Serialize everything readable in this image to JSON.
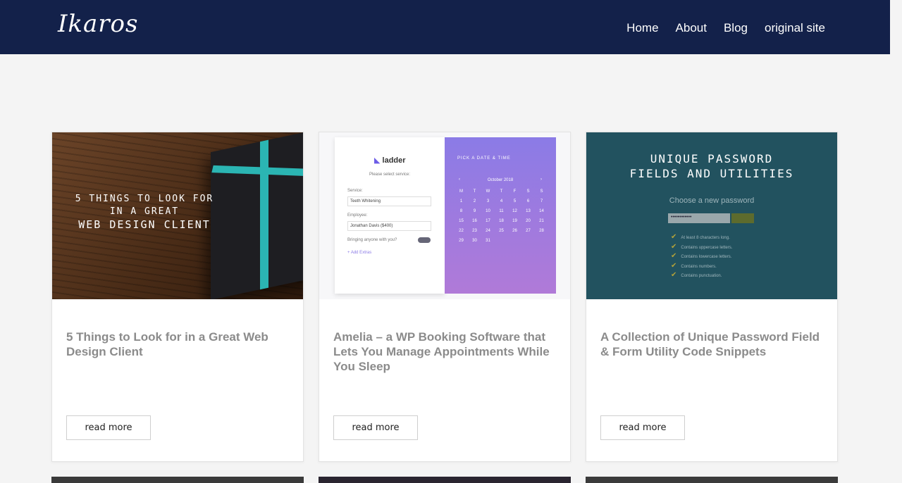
{
  "header": {
    "logo": "Ikaros",
    "nav": [
      "Home",
      "About",
      "Blog",
      "original site"
    ]
  },
  "cards": [
    {
      "title": "5 Things to Look for in a Great Web Design Client",
      "button": "read more",
      "thumb_lines": [
        "5 THINGS TO LOOK FOR",
        "IN A GREAT",
        "WEB DESIGN CLIENT"
      ]
    },
    {
      "title": "Amelia – a WP Booking Software that Lets You Manage Appointments While You Sleep",
      "button": "read more",
      "thumb": {
        "brand": "ladder",
        "select_service": "Please select service:",
        "service_label": "Service:",
        "service_value": "Teeth Whitening",
        "employee_label": "Employee:",
        "employee_value": "Jonathan Davis ($400)",
        "bringing": "Bringing anyone with you?",
        "extras": "Add Extras",
        "pick": "PICK A DATE & TIME",
        "month": "October 2018",
        "weekdays": [
          "M",
          "T",
          "W",
          "T",
          "F",
          "S",
          "S"
        ],
        "days": [
          "1",
          "2",
          "3",
          "4",
          "5",
          "6",
          "7",
          "8",
          "9",
          "10",
          "11",
          "12",
          "13",
          "14",
          "15",
          "16",
          "17",
          "18",
          "19",
          "20",
          "21",
          "22",
          "23",
          "24",
          "25",
          "26",
          "27",
          "28",
          "29",
          "30",
          "31"
        ]
      }
    },
    {
      "title": "A Collection of Unique Password Field & Form Utility Code Snippets",
      "button": "read more",
      "thumb": {
        "title_lines": [
          "UNIQUE PASSWORD",
          "FIELDS AND UTILITIES"
        ],
        "sub": "Choose a new password",
        "input_value": "••••••••••••",
        "checks": [
          "At least 8 characters long.",
          "Contains uppercase letters.",
          "Contains lowercase letters.",
          "Contains numbers.",
          "Contains punctuation."
        ]
      }
    }
  ],
  "colors": {
    "header_bg": "#13214a",
    "accent_ribbon": "#2bb5b3",
    "calendar_gradient_top": "#8b7be6",
    "password_bg": "#22525f"
  }
}
